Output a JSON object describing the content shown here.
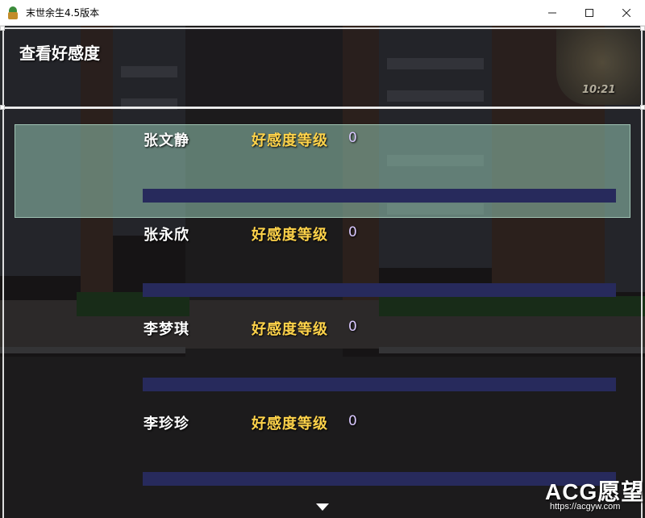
{
  "window": {
    "title": "末世余生4.5版本",
    "controls": [
      "minimize",
      "maximize",
      "close"
    ]
  },
  "screen": {
    "title": "查看好感度",
    "clock": "10:21"
  },
  "affection_label": "好感度等级",
  "characters": [
    {
      "name": "张文静",
      "level": "0",
      "progress": 0,
      "selected": true
    },
    {
      "name": "张永欣",
      "level": "0",
      "progress": 0,
      "selected": false
    },
    {
      "name": "李梦琪",
      "level": "0",
      "progress": 0,
      "selected": false
    },
    {
      "name": "李珍珍",
      "level": "0",
      "progress": 0,
      "selected": false
    }
  ],
  "more_indicator": "down-arrow",
  "watermark": {
    "brand": "ACG愿望",
    "url": "https://acgyw.com"
  },
  "colors": {
    "affection_label": "#ffd34a",
    "bar_track": "#272a5c",
    "highlight": "#96c8b4",
    "level_value": "#d9c8ff"
  }
}
